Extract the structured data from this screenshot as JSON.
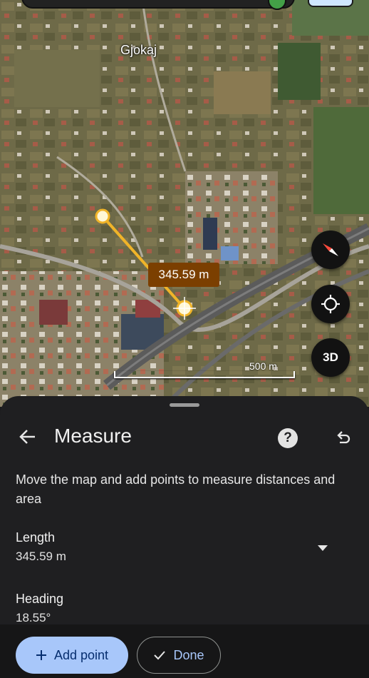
{
  "map": {
    "place_label": "Gjokaj",
    "distance_label": "345.59 m",
    "scale_label": "500 m",
    "btn_3d": "3D",
    "icons": [
      "compass-icon",
      "my-location-icon",
      "layers-icon"
    ]
  },
  "sheet": {
    "title": "Measure",
    "help_label": "?",
    "description": "Move the map and add points to measure distances and area",
    "length_label": "Length",
    "length_value": "345.59 m",
    "heading_label": "Heading",
    "heading_value": "18.55°",
    "icons": [
      "back-arrow-icon",
      "help-icon",
      "undo-icon",
      "chevron-down-icon"
    ]
  },
  "actions": {
    "add_point_label": "Add point",
    "done_label": "Done",
    "icons": [
      "plus-icon",
      "check-icon"
    ]
  },
  "colors": {
    "measure_line": "#f0b429",
    "distance_label_bg": "#7b3f00",
    "primary_button": "#a8c7fa",
    "sheet_bg": "#1f1f21"
  }
}
